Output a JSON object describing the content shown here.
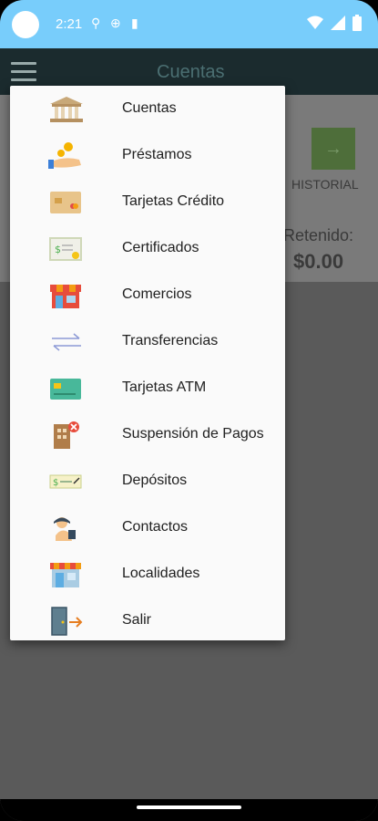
{
  "status_bar": {
    "time": "2:21"
  },
  "app_bar": {
    "title": "Cuentas"
  },
  "background_card": {
    "history_label": "HISTORIAL",
    "history_arrow": "→",
    "retenido_label": "Retenido:",
    "retenido_value": "$0.00"
  },
  "menu": {
    "items": [
      {
        "label": "Cuentas",
        "icon": "bank-icon"
      },
      {
        "label": "Préstamos",
        "icon": "loan-hand-coins-icon"
      },
      {
        "label": "Tarjetas Crédito",
        "icon": "credit-card-icon"
      },
      {
        "label": "Certificados",
        "icon": "certificate-icon"
      },
      {
        "label": "Comercios",
        "icon": "store-icon"
      },
      {
        "label": "Transferencias",
        "icon": "transfer-arrows-icon"
      },
      {
        "label": "Tarjetas ATM",
        "icon": "atm-card-icon"
      },
      {
        "label": "Suspensión de Pagos",
        "icon": "payment-suspension-icon"
      },
      {
        "label": "Depósitos",
        "icon": "deposit-check-icon"
      },
      {
        "label": "Contactos",
        "icon": "contact-icon"
      },
      {
        "label": "Localidades",
        "icon": "location-building-icon"
      },
      {
        "label": "Salir",
        "icon": "exit-door-icon"
      }
    ]
  },
  "colors": {
    "status_bar": "#78cdfb",
    "app_bar": "#1b2b2e",
    "menu_bg": "#fafafa"
  }
}
